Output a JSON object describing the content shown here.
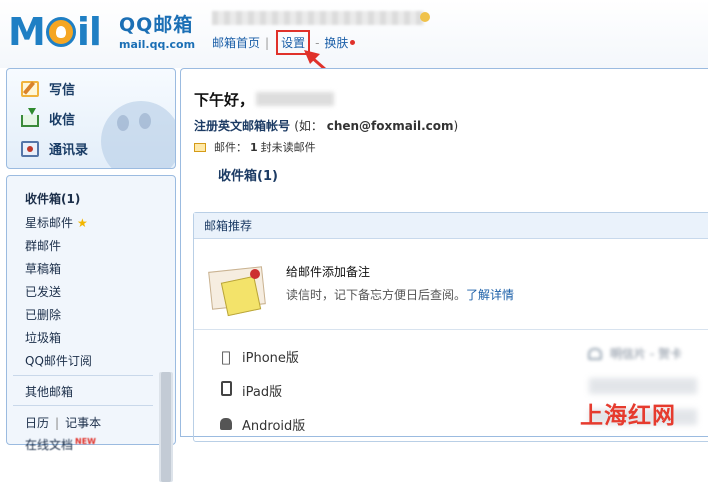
{
  "header": {
    "logo_text": "MOil",
    "brand_name": "QQ邮箱",
    "brand_url": "mail.qq.com",
    "nav": {
      "home": "邮箱首页",
      "separator": "|",
      "settings": "设置",
      "dash": "-",
      "skin": "换肤"
    }
  },
  "sidebar": {
    "actions": {
      "write": "写信",
      "receive": "收信",
      "contacts": "通讯录"
    },
    "folders": {
      "inbox": "收件箱(1)",
      "starred": "星标邮件",
      "group": "群邮件",
      "drafts": "草稿箱",
      "sent": "已发送",
      "deleted": "已删除",
      "spam": "垃圾箱",
      "subscription": "QQ邮件订阅",
      "other": "其他邮箱",
      "calendar": "日历",
      "pipe": "|",
      "notes": "记事本",
      "docs": "在线文档",
      "docs_badge": "NEW"
    }
  },
  "main": {
    "greeting": "下午好，",
    "register_label": "注册英文邮箱帐号",
    "register_example_prefix": "(如：",
    "register_example_value": "chen@foxmail.com",
    "register_example_suffix": ")",
    "unread_prefix": "邮件：",
    "unread_count": "1",
    "unread_suffix": "封未读邮件",
    "inbox_link": "收件箱(1)",
    "recommend": {
      "header": "邮箱推荐",
      "title": "给邮件添加备注",
      "desc": "读信时，记下备忘方便日后查阅。",
      "more_link": "了解详情",
      "clients": [
        "iPhone版",
        "iPad版",
        "Android版"
      ],
      "postcard": "明信片 - 贺卡"
    }
  },
  "watermark": "上海红网",
  "colors": {
    "brand_blue": "#1b6fb5",
    "highlight_red": "#e0312a",
    "panel_border": "#9bbbe0"
  }
}
